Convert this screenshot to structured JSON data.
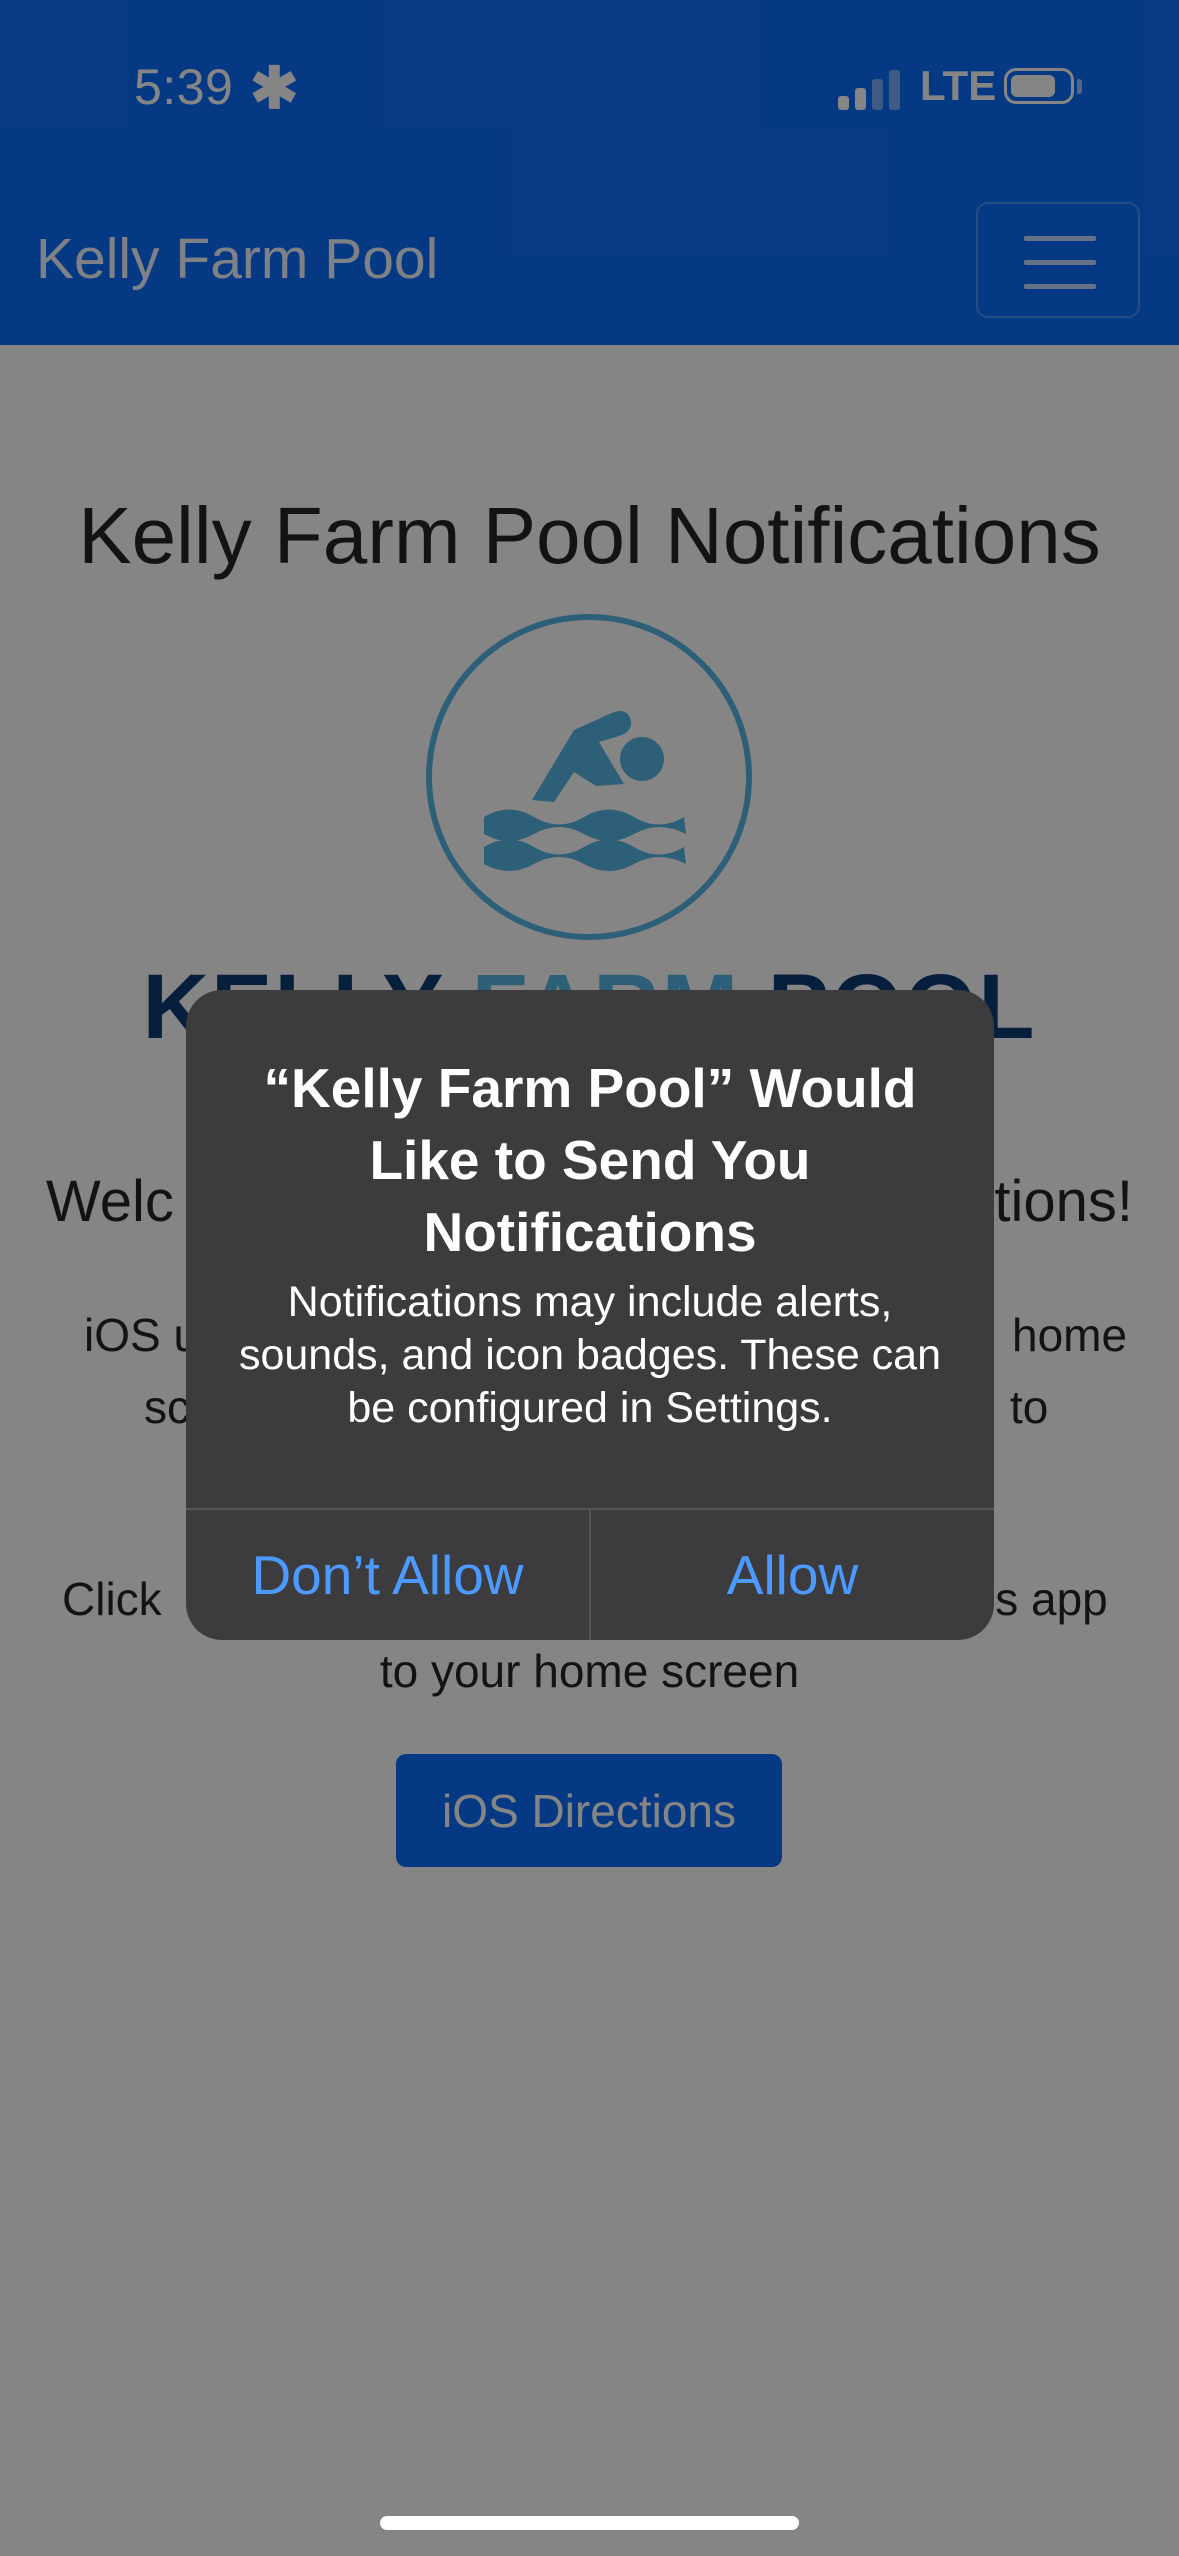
{
  "status_bar": {
    "time": "5:39",
    "focus_glyph": "✱",
    "network": "LTE",
    "icons": [
      "signal-icon",
      "battery-icon"
    ]
  },
  "navbar": {
    "brand": "Kelly Farm Pool",
    "menu_icon": "hamburger-menu-icon"
  },
  "main": {
    "title": "Kelly Farm Pool Notifications",
    "logo_icon": "swimmer-icon",
    "logo_text": {
      "part1": "KELLY ",
      "part2": "FARM",
      "part3": " POOL"
    },
    "welcome_left": "Welc",
    "welcome_right": "tions!",
    "ios_line1_left": "iOS u",
    "ios_line1_right": "home",
    "ios_line2_left": "sc",
    "ios_line2_right": "to",
    "click_left": "Click ",
    "click_right": "is app",
    "click_line2": "to your home screen",
    "ios_button": "iOS Directions"
  },
  "alert": {
    "title": "“Kelly Farm Pool” Would Like to Send You Notifications",
    "message": "Notifications may include alerts, sounds, and icon badges. These can be configured in Settings.",
    "deny": "Don’t Allow",
    "allow": "Allow"
  },
  "colors": {
    "primary": "#0d6efd",
    "alert_bg": "#3c3c3e",
    "alert_button": "#4c9aff",
    "logo_teal": "#56b7e6"
  }
}
